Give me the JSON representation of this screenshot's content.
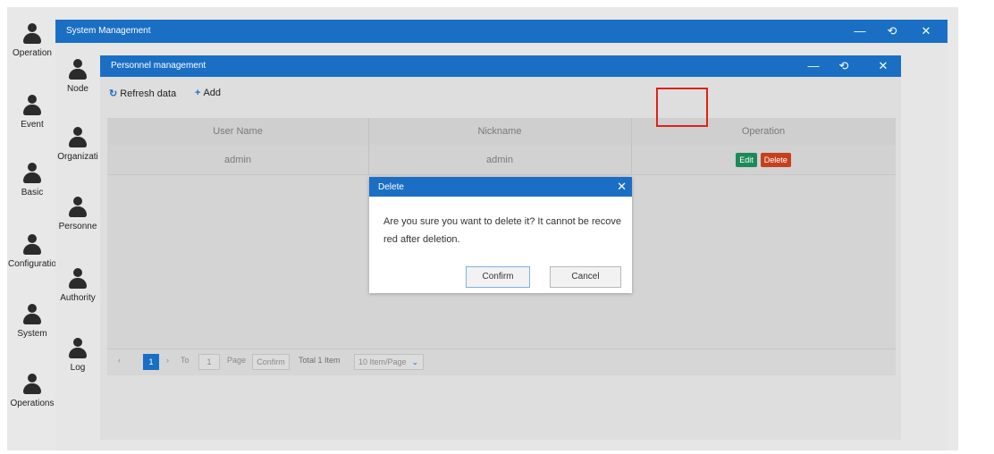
{
  "left_sidebar": {
    "items": [
      {
        "label": "Operation",
        "icon": "user-icon"
      },
      {
        "label": "Event",
        "icon": "user-icon"
      },
      {
        "label": "Basic",
        "icon": "user-icon"
      },
      {
        "label": "Configuratio",
        "icon": "user-icon"
      },
      {
        "label": "System",
        "icon": "user-icon"
      },
      {
        "label": "Operations",
        "icon": "user-icon"
      }
    ]
  },
  "system_window": {
    "title": "System Management",
    "controls": {
      "minimize": "—",
      "restore": "⟲",
      "close": "✕"
    }
  },
  "sub_sidebar": {
    "items": [
      {
        "label": "Node",
        "icon": "user-icon"
      },
      {
        "label": "Organizati",
        "icon": "user-icon"
      },
      {
        "label": "Personne",
        "icon": "user-icon"
      },
      {
        "label": "Authority",
        "icon": "user-icon"
      },
      {
        "label": "Log",
        "icon": "user-icon"
      }
    ]
  },
  "personnel_window": {
    "title": "Personnel management",
    "controls": {
      "minimize": "—",
      "restore": "⟲",
      "close": "✕"
    },
    "toolbar": {
      "refresh_label": "Refresh data",
      "add_label": "Add"
    },
    "table": {
      "columns": [
        "User Name",
        "Nickname",
        "Operation"
      ],
      "rows": [
        {
          "user_name": "admin",
          "nickname": "admin",
          "edit_label": "Edit",
          "delete_label": "Delete"
        }
      ]
    },
    "pagination": {
      "current_page": "1",
      "to_label": "To",
      "to_value": "1",
      "page_label": "Page",
      "confirm_label": "Confirm",
      "total_label": "Total 1 Item",
      "page_size_label": "10 Item/Page"
    }
  },
  "dialog": {
    "title": "Delete",
    "message": "Are you sure you want to delete it? It cannot be recovered after deletion.",
    "confirm_label": "Confirm",
    "cancel_label": "Cancel"
  },
  "colors": {
    "title_bar": "#1a6fc4",
    "edit_button": "#1c8a58",
    "delete_button": "#c6401d",
    "highlight": "#e0201a"
  }
}
